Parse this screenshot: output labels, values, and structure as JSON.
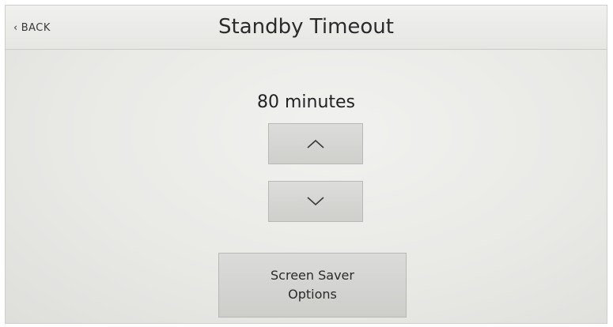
{
  "header": {
    "back_label": "BACK",
    "back_icon": "chevron-left-icon",
    "title": "Standby Timeout"
  },
  "timeout": {
    "value_text": "80 minutes",
    "increase_icon": "chevron-up-icon",
    "decrease_icon": "chevron-down-icon"
  },
  "screen_saver_button": {
    "label": "Screen Saver\nOptions"
  },
  "colors": {
    "background": "#e9e9e6",
    "button": "#d5d5d2",
    "text": "#2b2b2b"
  }
}
